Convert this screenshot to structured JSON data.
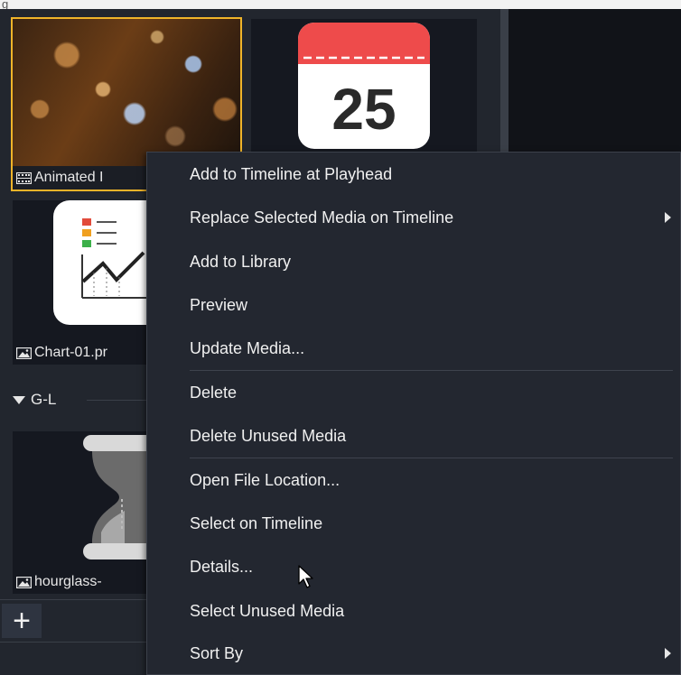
{
  "topbar": {
    "cut_text": "g"
  },
  "tiles": [
    {
      "name": "Animated Background",
      "caption": "Animated I",
      "icon": "film-icon",
      "selected": true
    },
    {
      "name": "Calendar",
      "caption": "",
      "icon": "image-icon",
      "thumb_text": "25"
    },
    {
      "name": "Chart",
      "caption": "Chart-01.pr",
      "icon": "image-icon"
    },
    {
      "name": "Hourglass",
      "caption": "hourglass-",
      "icon": "image-icon"
    }
  ],
  "section": {
    "label": "G-L"
  },
  "add_button": {
    "label": "+"
  },
  "context_menu": {
    "items": [
      {
        "label": "Add to Timeline at Playhead"
      },
      {
        "label": "Replace Selected Media on Timeline",
        "submenu": true
      },
      {
        "label": "Add to Library"
      },
      {
        "label": "Preview"
      },
      {
        "label": "Update Media..."
      },
      {
        "label": "Delete"
      },
      {
        "label": "Delete Unused Media"
      },
      {
        "label": "Open File Location..."
      },
      {
        "label": "Select on Timeline"
      },
      {
        "label": "Details..."
      },
      {
        "label": "Select Unused Media"
      },
      {
        "label": "Sort By",
        "submenu": true
      }
    ]
  },
  "colors": {
    "selection": "#f0b429",
    "menu_bg": "#232730",
    "panel_bg": "#22262e"
  }
}
